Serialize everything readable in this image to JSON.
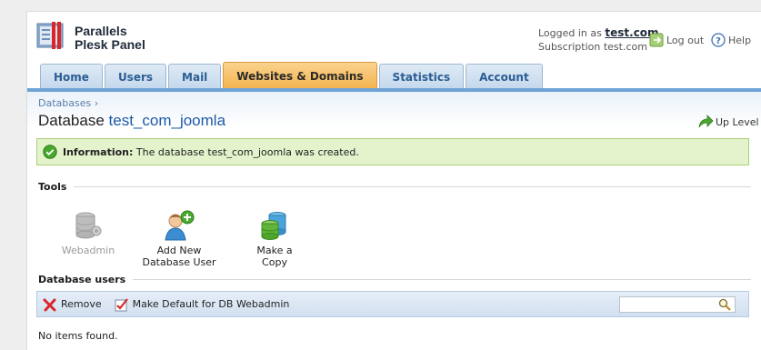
{
  "brand": {
    "line1": "Parallels",
    "line2": "Plesk Panel"
  },
  "header": {
    "logged_in_prefix": "Logged in as",
    "username": "test.com",
    "subscription": "Subscription test.com",
    "logout_label": "Log out",
    "help_label": "Help"
  },
  "tabs": [
    {
      "label": "Home"
    },
    {
      "label": "Users"
    },
    {
      "label": "Mail"
    },
    {
      "label": "Websites & Domains",
      "active": true
    },
    {
      "label": "Statistics"
    },
    {
      "label": "Account"
    }
  ],
  "breadcrumb": "Databases ›",
  "page": {
    "title_prefix": "Database",
    "title_name": "test_com_joomla",
    "up_level": "Up Level"
  },
  "message": {
    "label": "Information:",
    "text": "The database test_com_joomla was created."
  },
  "tools": {
    "heading": "Tools",
    "items": [
      {
        "label": "Webadmin",
        "enabled": false,
        "icon": "database-admin-icon"
      },
      {
        "label": "Add New Database User",
        "enabled": true,
        "icon": "add-user-icon"
      },
      {
        "label": "Make a Copy",
        "enabled": true,
        "icon": "copy-database-icon"
      }
    ]
  },
  "db_users": {
    "heading": "Database users",
    "remove_label": "Remove",
    "make_default_label": "Make Default for DB Webadmin",
    "search_value": "",
    "empty_text": "No items found."
  }
}
